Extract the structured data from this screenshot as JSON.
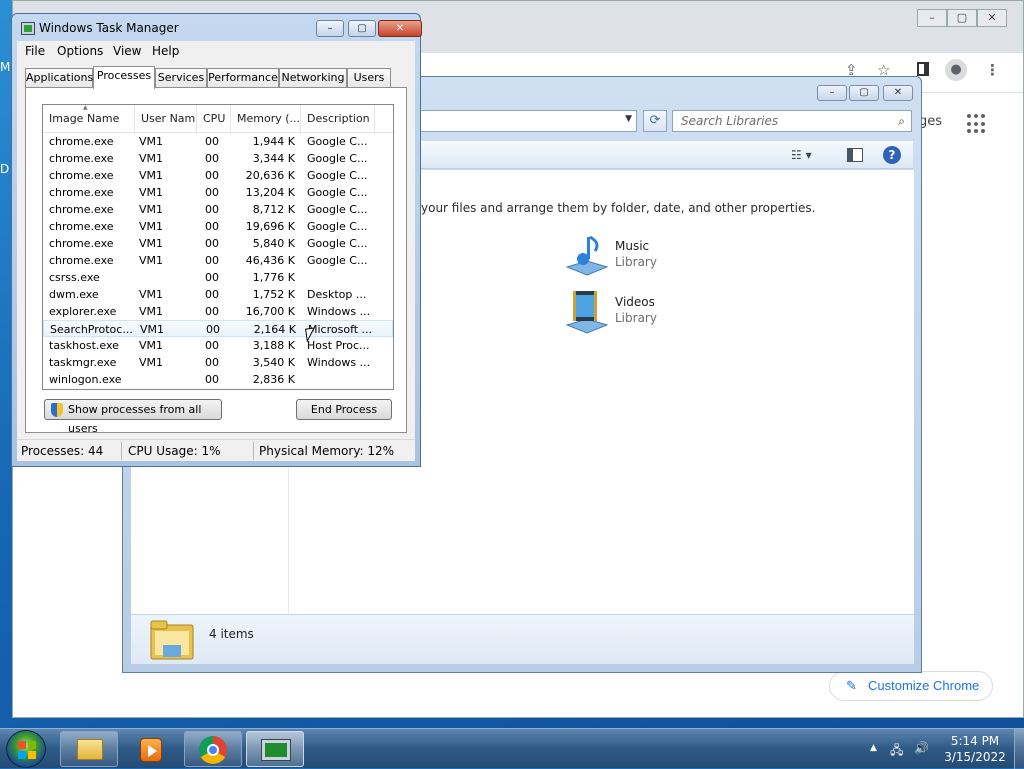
{
  "desktop": {
    "fragments": [
      "M",
      "D"
    ]
  },
  "chrome": {
    "pages_label": "ges",
    "customize_label": "Customize Chrome",
    "window_buttons": [
      "–",
      "▢",
      "✕"
    ]
  },
  "explorer": {
    "search_placeholder": "Search Libraries",
    "description": "your files and arrange them by folder, date, and other properties.",
    "libraries": [
      {
        "name": "Music",
        "type": "Library"
      },
      {
        "name": "Videos",
        "type": "Library"
      }
    ],
    "status_count": "4 items"
  },
  "taskmgr": {
    "title": "Windows Task Manager",
    "menu": [
      "File",
      "Options",
      "View",
      "Help"
    ],
    "tabs": [
      "Applications",
      "Processes",
      "Services",
      "Performance",
      "Networking",
      "Users"
    ],
    "active_tab": "Processes",
    "columns": [
      "Image Name",
      "User Name",
      "CPU",
      "Memory (...",
      "Description"
    ],
    "rows": [
      {
        "image": "chrome.exe",
        "user": "VM1",
        "cpu": "00",
        "memory": "1,944 K",
        "desc": "Google C..."
      },
      {
        "image": "chrome.exe",
        "user": "VM1",
        "cpu": "00",
        "memory": "3,344 K",
        "desc": "Google C..."
      },
      {
        "image": "chrome.exe",
        "user": "VM1",
        "cpu": "00",
        "memory": "20,636 K",
        "desc": "Google C..."
      },
      {
        "image": "chrome.exe",
        "user": "VM1",
        "cpu": "00",
        "memory": "13,204 K",
        "desc": "Google C..."
      },
      {
        "image": "chrome.exe",
        "user": "VM1",
        "cpu": "00",
        "memory": "8,712 K",
        "desc": "Google C..."
      },
      {
        "image": "chrome.exe",
        "user": "VM1",
        "cpu": "00",
        "memory": "19,696 K",
        "desc": "Google C..."
      },
      {
        "image": "chrome.exe",
        "user": "VM1",
        "cpu": "00",
        "memory": "5,840 K",
        "desc": "Google C..."
      },
      {
        "image": "chrome.exe",
        "user": "VM1",
        "cpu": "00",
        "memory": "46,436 K",
        "desc": "Google C..."
      },
      {
        "image": "csrss.exe",
        "user": "",
        "cpu": "00",
        "memory": "1,776 K",
        "desc": ""
      },
      {
        "image": "dwm.exe",
        "user": "VM1",
        "cpu": "00",
        "memory": "1,752 K",
        "desc": "Desktop ..."
      },
      {
        "image": "explorer.exe",
        "user": "VM1",
        "cpu": "00",
        "memory": "16,700 K",
        "desc": "Windows ..."
      },
      {
        "image": "SearchProtoc...",
        "user": "VM1",
        "cpu": "00",
        "memory": "2,164 K",
        "desc": "Microsoft ..."
      },
      {
        "image": "taskhost.exe",
        "user": "VM1",
        "cpu": "00",
        "memory": "3,188 K",
        "desc": "Host Proc..."
      },
      {
        "image": "taskmgr.exe",
        "user": "VM1",
        "cpu": "00",
        "memory": "3,540 K",
        "desc": "Windows ..."
      },
      {
        "image": "winlogon.exe",
        "user": "",
        "cpu": "00",
        "memory": "2,836 K",
        "desc": ""
      }
    ],
    "show_all_label": "Show processes from all users",
    "end_process_label": "End Process",
    "status": {
      "processes": "Processes: 44",
      "cpu": "CPU Usage: 1%",
      "memory": "Physical Memory: 12%"
    }
  },
  "taskbar": {
    "time": "5:14 PM",
    "date": "3/15/2022"
  },
  "icons": [
    "windows-start-icon",
    "folder-icon",
    "media-player-icon",
    "chrome-icon",
    "task-manager-icon",
    "shield-icon",
    "search-icon",
    "refresh-icon",
    "help-icon",
    "view-options-icon",
    "preview-pane-icon",
    "apps-grid-icon",
    "pencil-icon",
    "share-icon",
    "star-icon",
    "profile-icon",
    "menu-dots-icon",
    "network-icon",
    "volume-icon",
    "tray-arrow-icon"
  ],
  "colors": {
    "desktop": "#1767b5",
    "chrome_accent": "#1a73e8",
    "taskbar": "#2f5a86"
  }
}
